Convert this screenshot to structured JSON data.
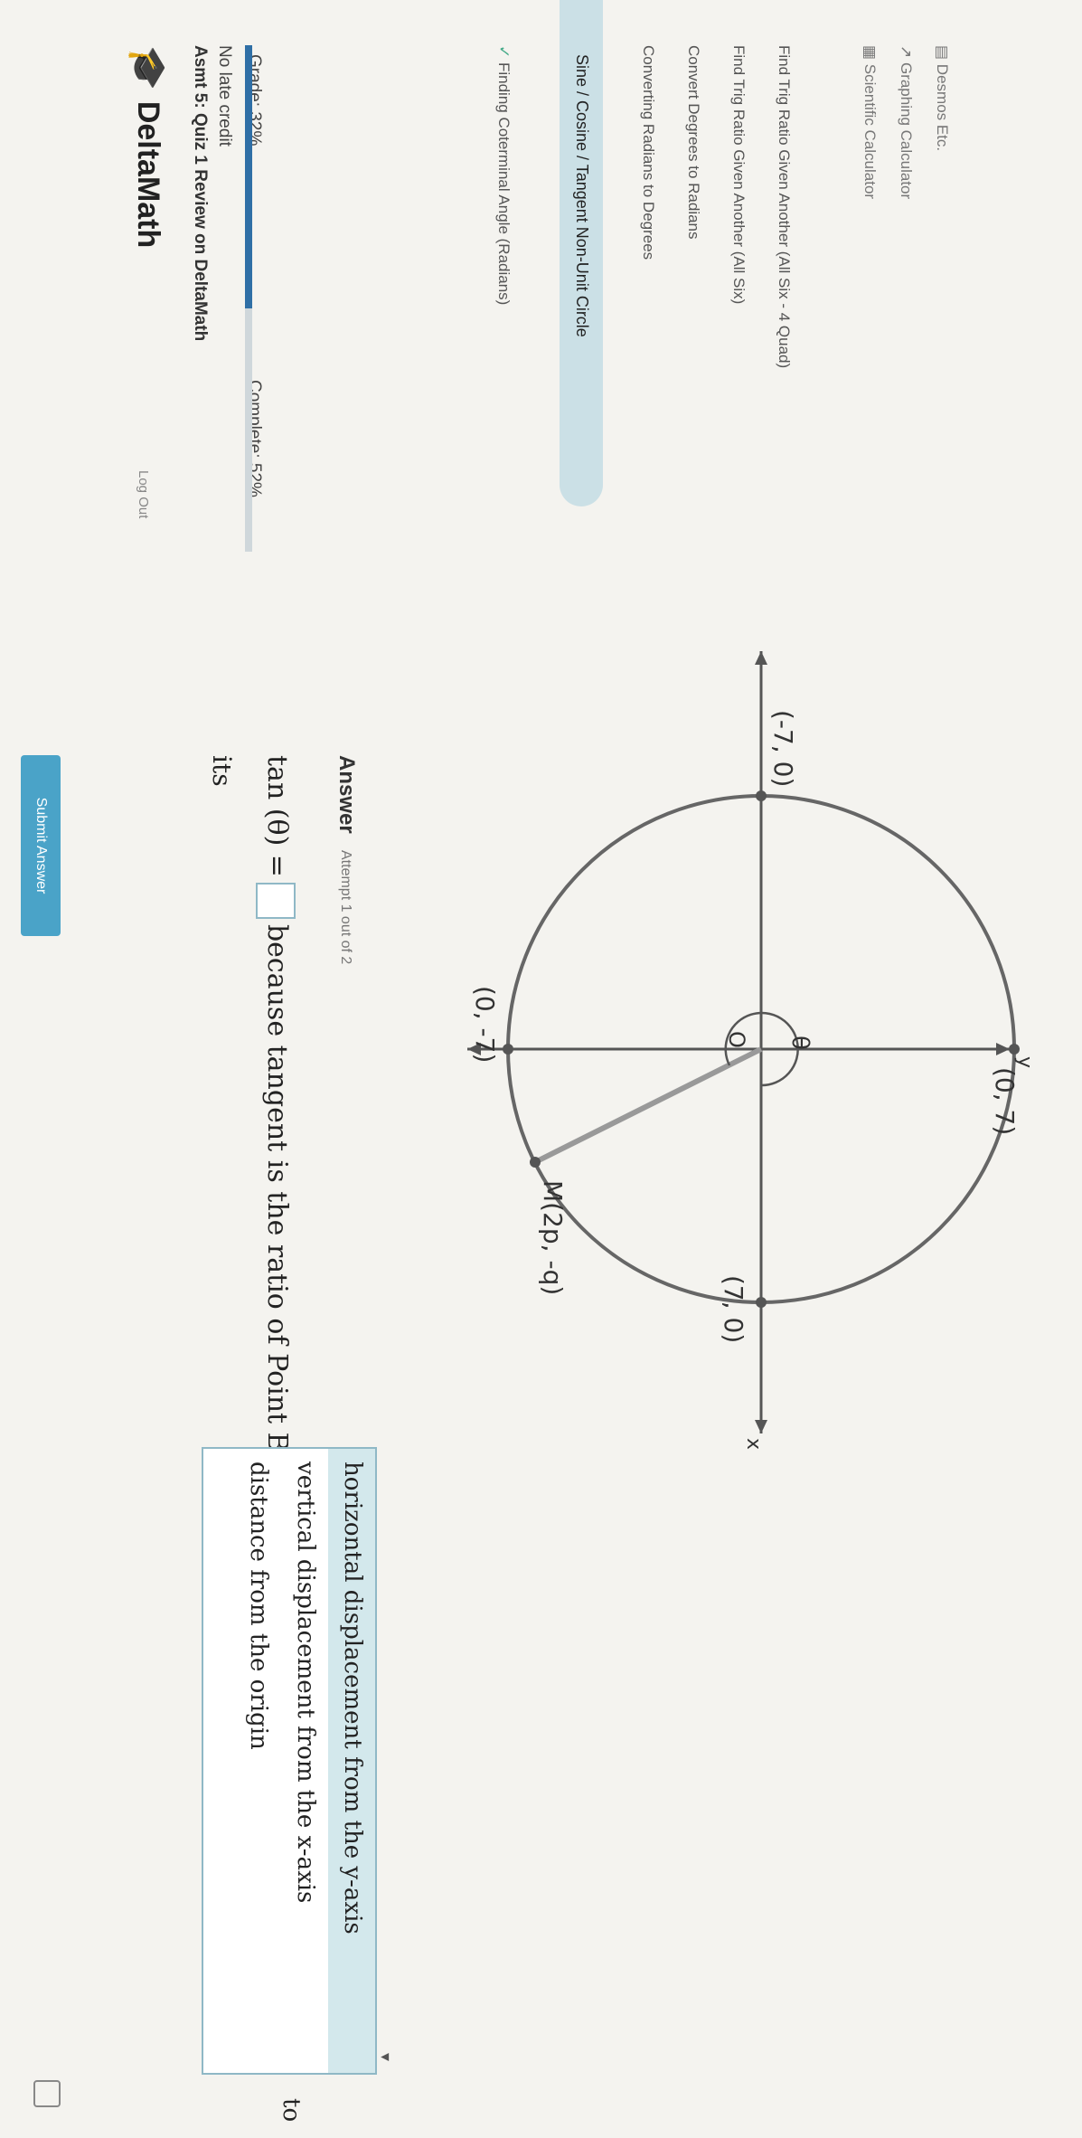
{
  "app": {
    "logo_text": "DeltaMath"
  },
  "assignment": {
    "title": "Asmt 5: Quiz 1 Review on DeltaMath",
    "late_credit": "No late credit",
    "grade": "Grade: 32%",
    "complete": "Complete: 52%",
    "progress_fraction": 0.52
  },
  "skills": [
    {
      "label": "Finding Coterminal Angle (Radians)",
      "status": "check"
    },
    {
      "label": "Sine / Cosine / Tangent Non-Unit Circle",
      "status": "active"
    },
    {
      "label": "Converting Radians to Degrees",
      "status": "none"
    },
    {
      "label": "Convert Degrees to Radians",
      "status": "none"
    },
    {
      "label": "Find Trig Ratio Given Another (All Six)",
      "status": "none"
    },
    {
      "label": "Find Trig Ratio Given Another (All Six - 4 Quad)",
      "status": "none"
    }
  ],
  "tools": {
    "scientific_calculator": "Scientific Calculator",
    "graphing_calculator": "Graphing Calculator",
    "desmos": "Desmos Etc.",
    "log_out": "Log Out"
  },
  "diagram": {
    "label_top": "(0, 7)",
    "label_right": "(7, 0)",
    "label_left": "(-7, 0)",
    "label_bottom": "(0, -7)",
    "label_point": "M(2p, -q)",
    "label_theta": "θ",
    "label_origin": "O",
    "label_x": "x",
    "label_y": "y"
  },
  "answer": {
    "label": "Answer",
    "attempt": "Attempt 1 out of 2",
    "eq_prefix": "tan (θ) =",
    "eq_suffix": "because tangent is the ratio of Point B's",
    "its": "its",
    "to": "to",
    "options": [
      "horizontal displacement from the y-axis",
      "vertical displacement from the x-axis",
      "distance from the origin"
    ],
    "submit": "Submit Answer"
  }
}
